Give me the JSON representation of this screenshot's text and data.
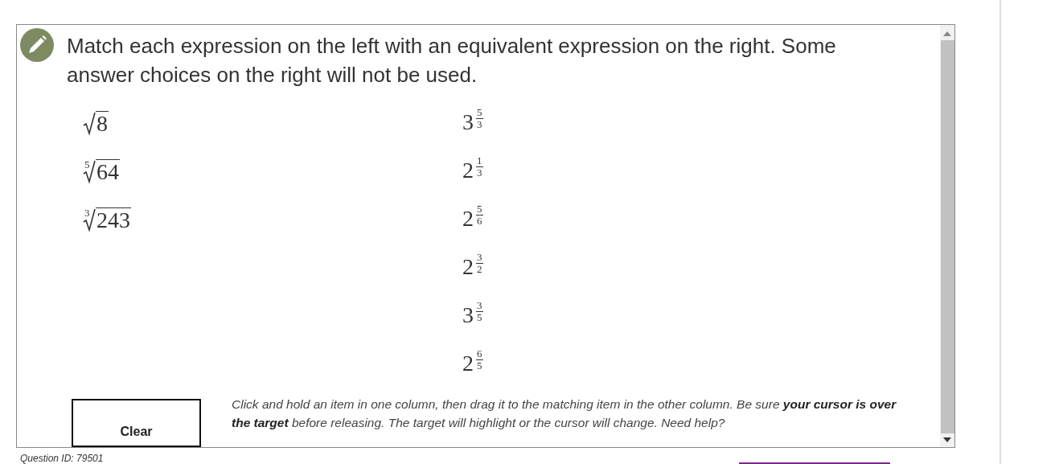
{
  "question": {
    "prompt": "Match each expression on the left with an equivalent expression on the right. Some answer choices on the right will not be used.",
    "left_items": [
      {
        "radicand": "8"
      },
      {
        "index": "5",
        "radicand": "64"
      },
      {
        "index": "3",
        "radicand": "243"
      }
    ],
    "right_items": [
      {
        "base": "3",
        "numerator": "5",
        "denominator": "3"
      },
      {
        "base": "2",
        "numerator": "1",
        "denominator": "3"
      },
      {
        "base": "2",
        "numerator": "5",
        "denominator": "6"
      },
      {
        "base": "2",
        "numerator": "3",
        "denominator": "2"
      },
      {
        "base": "3",
        "numerator": "3",
        "denominator": "5"
      },
      {
        "base": "2",
        "numerator": "6",
        "denominator": "5"
      }
    ],
    "clear_button": "Clear",
    "instructions": "Click and hold an item in one column, then drag it to the matching item in the other column. Be sure **your cursor is over the target** before releasing. The target will highlight or the cursor will change. Need help?"
  },
  "question_id": "Question ID: 79501"
}
